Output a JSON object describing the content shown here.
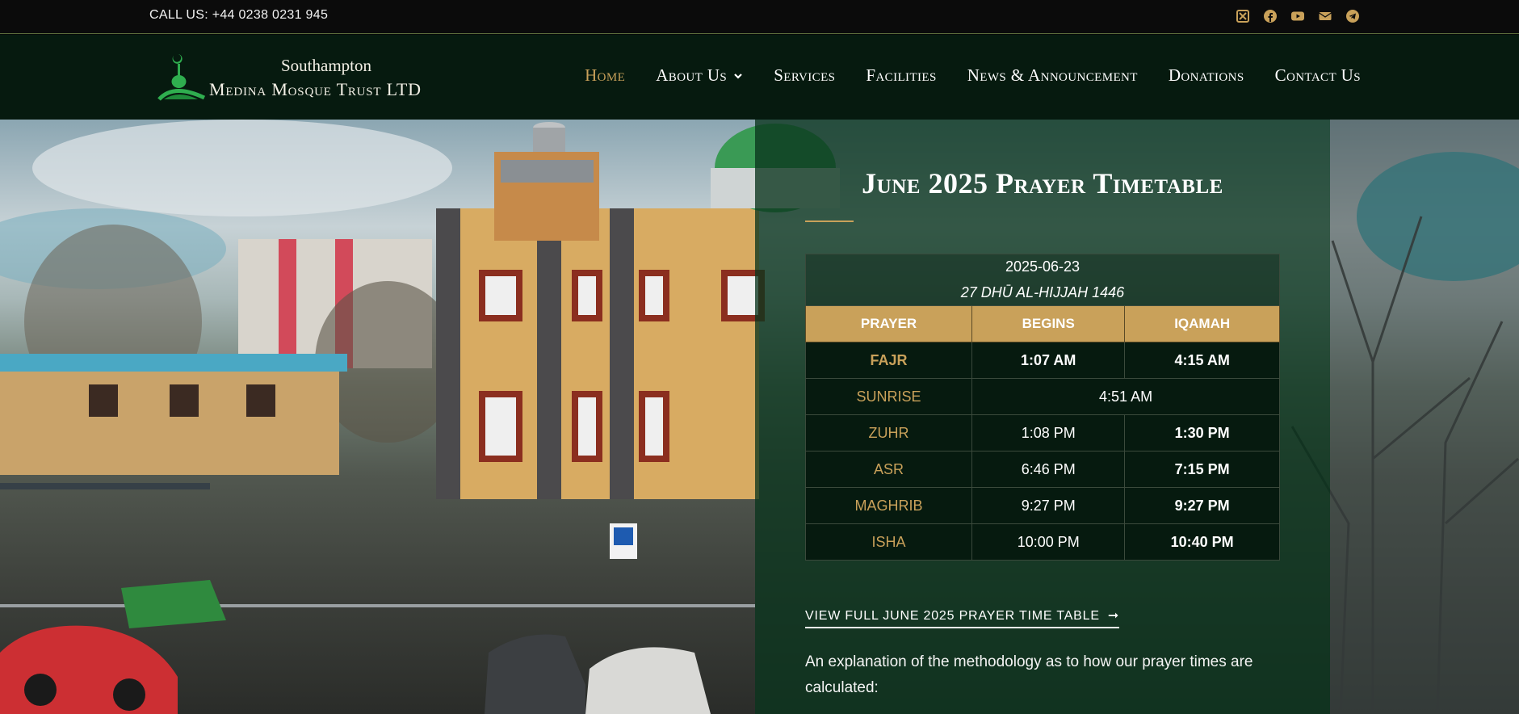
{
  "topbar": {
    "phone": "CALL US: +44 0238 0231 945",
    "social_icons": [
      "x-icon",
      "facebook-icon",
      "youtube-icon",
      "email-icon",
      "telegram-icon"
    ]
  },
  "brand": {
    "line1": "Southampton",
    "line2": "Medina Mosque Trust LTD"
  },
  "nav": {
    "items": [
      {
        "label": "Home",
        "active": true
      },
      {
        "label": "About Us",
        "dropdown": true
      },
      {
        "label": "Services"
      },
      {
        "label": "Facilities"
      },
      {
        "label": "News & Announcement"
      },
      {
        "label": "Donations"
      },
      {
        "label": "Contact Us"
      }
    ]
  },
  "timetable": {
    "title": "June 2025 Prayer Timetable",
    "date": "2025-06-23",
    "hijri": "27 DHŪ AL-HIJJAH 1446",
    "headers": [
      "PRAYER",
      "BEGINS",
      "IQAMAH"
    ],
    "rows": [
      {
        "prayer": "FAJR",
        "begins": "1:07 AM",
        "iqamah": "4:15 AM"
      },
      {
        "prayer": "SUNRISE",
        "time": "4:51 AM"
      },
      {
        "prayer": "ZUHR",
        "begins": "1:08 PM",
        "iqamah": "1:30 PM"
      },
      {
        "prayer": "ASR",
        "begins": "6:46 PM",
        "iqamah": "7:15 PM"
      },
      {
        "prayer": "MAGHRIB",
        "begins": "9:27 PM",
        "iqamah": "9:27 PM"
      },
      {
        "prayer": "ISHA",
        "begins": "10:00 PM",
        "iqamah": "10:40 PM"
      }
    ],
    "full_link": "VIEW FULL JUNE 2025 PRAYER TIME TABLE",
    "explanation": "An explanation of the methodology as to how our prayer times are calculated:"
  },
  "colors": {
    "accent_gold": "#c9a15a",
    "header_green": "#061a0f",
    "overlay_green": "#0a341e"
  }
}
